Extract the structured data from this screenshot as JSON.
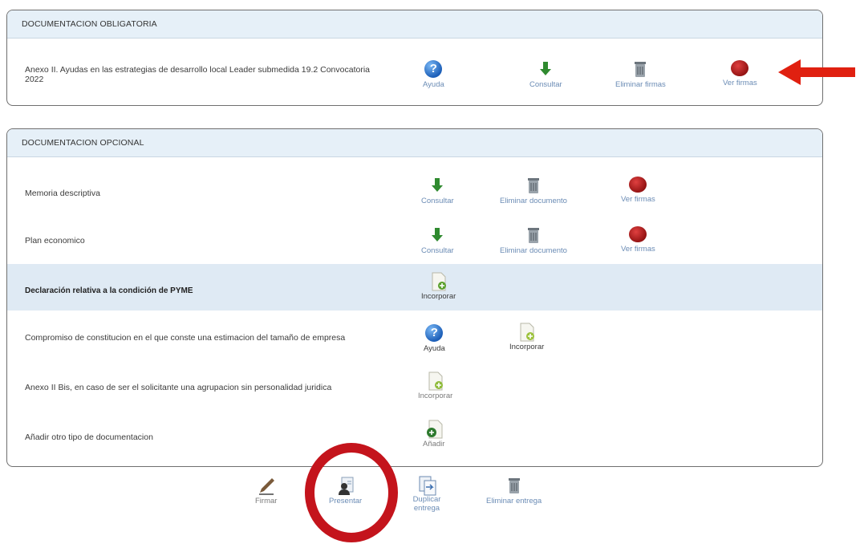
{
  "mandatory": {
    "title": "DOCUMENTACION OBLIGATORIA",
    "row": {
      "label": "Anexo II. Ayudas en las estrategias de desarrollo local Leader submedida 19.2 Convocatoria 2022",
      "actions": {
        "help": "Ayuda",
        "consult": "Consultar",
        "delete_signatures": "Eliminar firmas",
        "view_signatures": "Ver firmas"
      }
    }
  },
  "optional": {
    "title": "DOCUMENTACION OPCIONAL",
    "rows": [
      {
        "label": "Memoria descriptiva",
        "consult": "Consultar",
        "delete": "Eliminar documento",
        "view": "Ver firmas"
      },
      {
        "label": "Plan economico",
        "consult": "Consultar",
        "delete": "Eliminar documento",
        "view": "Ver firmas"
      },
      {
        "label": "Declaración relativa a la condición de PYME",
        "add": "Incorporar"
      },
      {
        "label": "Compromiso de constitucion en el que conste una estimacion del tamaño de empresa",
        "help": "Ayuda",
        "add": "Incorporar"
      },
      {
        "label": "Anexo II Bis, en caso de ser el solicitante una agrupacion sin personalidad juridica",
        "add": "Incorporar"
      },
      {
        "label": "Añadir otro tipo de documentacion",
        "add": "Añadir"
      }
    ]
  },
  "toolbar": {
    "sign": "Firmar",
    "submit": "Presentar",
    "duplicate": "Duplicar entrega",
    "delete_delivery": "Eliminar entrega"
  },
  "colors": {
    "annotation_red": "#e02010",
    "circle_red": "#c4141c",
    "header_bg": "#e6f0f8"
  }
}
